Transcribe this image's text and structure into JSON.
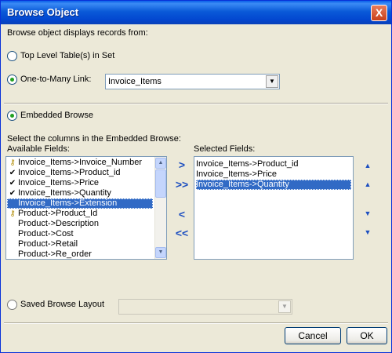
{
  "window": {
    "title": "Browse Object",
    "close_glyph": "X"
  },
  "intro_text": "Browse object displays records from:",
  "options": {
    "top_level_label": "Top Level Table(s) in Set",
    "one_to_many_label": "One-to-Many Link:",
    "one_to_many_value": "Invoice_Items",
    "embedded_label": "Embedded Browse",
    "saved_label": "Saved Browse Layout",
    "saved_value": ""
  },
  "select_text": "Select the columns in the Embedded Browse:",
  "available": {
    "label": "Available Fields:",
    "items": [
      {
        "text": "Invoice_Items->Invoice_Number",
        "icon": "key-icon",
        "selected": false
      },
      {
        "text": "Invoice_Items->Product_id",
        "icon": "check-icon",
        "selected": false
      },
      {
        "text": "Invoice_Items->Price",
        "icon": "check-icon",
        "selected": false
      },
      {
        "text": "Invoice_Items->Quantity",
        "icon": "check-icon",
        "selected": false
      },
      {
        "text": "Invoice_Items->Extension",
        "icon": "",
        "selected": true
      },
      {
        "text": "Product->Product_Id",
        "icon": "key-icon",
        "selected": false
      },
      {
        "text": "Product->Description",
        "icon": "",
        "selected": false
      },
      {
        "text": "Product->Cost",
        "icon": "",
        "selected": false
      },
      {
        "text": "Product->Retail",
        "icon": "",
        "selected": false
      },
      {
        "text": "Product->Re_order",
        "icon": "",
        "selected": false
      }
    ]
  },
  "selected": {
    "label": "Selected Fields:",
    "items": [
      {
        "text": "Invoice_Items->Product_id",
        "selected": false
      },
      {
        "text": "Invoice_Items->Price",
        "selected": false
      },
      {
        "text": "Invoice_Items->Quantity",
        "selected": true
      }
    ]
  },
  "move_buttons": {
    "add": ">",
    "add_all": ">>",
    "remove": "<",
    "remove_all": "<<"
  },
  "buttons": {
    "cancel": "Cancel",
    "ok": "OK"
  }
}
